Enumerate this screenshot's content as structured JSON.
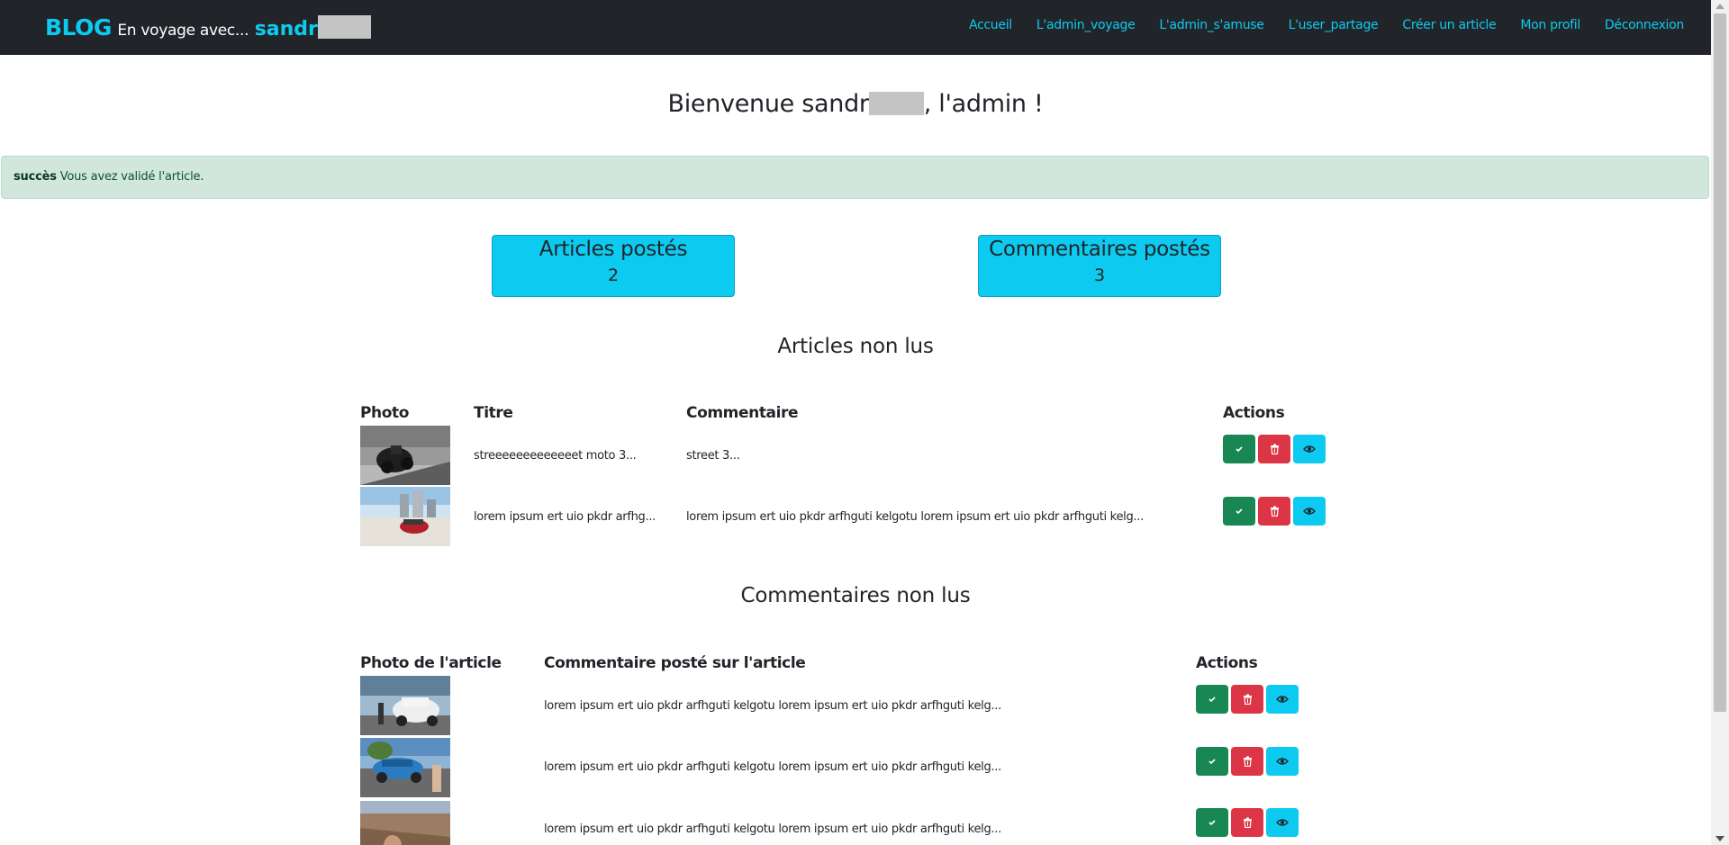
{
  "navbar": {
    "brand": "BLOG",
    "tagline": "En voyage avec...",
    "username": "sandr",
    "links": [
      "Accueil",
      "L'admin_voyage",
      "L'admin_s'amuse",
      "L'user_partage",
      "Créer un article",
      "Mon profil",
      "Déconnexion"
    ]
  },
  "welcome": {
    "prefix": "Bienvenue sandr",
    "suffix": ", l'admin !"
  },
  "alert": {
    "strong": "succès",
    "message": "Vous avez validé l'article."
  },
  "stats": [
    {
      "label": "Articles postés",
      "value": "2"
    },
    {
      "label": "Commentaires postés",
      "value": "3"
    }
  ],
  "articles": {
    "title": "Articles non lus",
    "headers": {
      "photo": "Photo",
      "titre": "Titre",
      "commentaire": "Commentaire",
      "actions": "Actions"
    },
    "rows": [
      {
        "titre": "streeeeeeeeeeeeet moto 3...",
        "commentaire": "street 3..."
      },
      {
        "titre": "lorem ipsum ert uio pkdr arfhg...",
        "commentaire": "lorem ipsum ert uio pkdr arfhguti kelgotu lorem ipsum ert uio pkdr arfhguti kelg..."
      }
    ]
  },
  "comments": {
    "title": "Commentaires non lus",
    "headers": {
      "photo": "Photo de l'article",
      "commentaire": "Commentaire posté sur l'article",
      "actions": "Actions"
    },
    "rows": [
      {
        "commentaire": "lorem ipsum ert uio pkdr arfhguti kelgotu lorem ipsum ert uio pkdr arfhguti kelg..."
      },
      {
        "commentaire": "lorem ipsum ert uio pkdr arfhguti kelgotu lorem ipsum ert uio pkdr arfhguti kelg..."
      },
      {
        "commentaire": "lorem ipsum ert uio pkdr arfhguti kelgotu lorem ipsum ert uio pkdr arfhguti kelg..."
      }
    ]
  },
  "icons": {
    "validate": "check-icon",
    "delete": "trash-icon",
    "view": "eye-icon"
  },
  "colors": {
    "navbar": "#212529",
    "accent": "#0dcaf0",
    "success": "#198754",
    "danger": "#dc3545",
    "alert_bg": "#d1e7dd"
  }
}
